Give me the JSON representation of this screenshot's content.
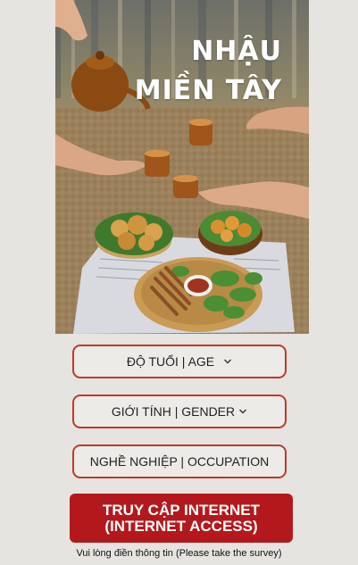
{
  "hero": {
    "title_line1": "NHẬU",
    "title_line2": "MIỀN TÂY"
  },
  "form": {
    "age_label": "ĐỘ TUỔI | AGE",
    "gender_label": "GIỚI TÍNH | GENDER",
    "occupation_label": "NGHỀ NGHIỆP | OCCUPATION"
  },
  "cta": {
    "line1": "TRUY CẬP INTERNET",
    "line2": "(INTERNET ACCESS)"
  },
  "footer": {
    "note": "Vui lòng điền thông tin (Please take the survey)"
  },
  "colors": {
    "accent": "#b3191c",
    "field_border": "#c0392b",
    "background": "#e5e4e0"
  }
}
